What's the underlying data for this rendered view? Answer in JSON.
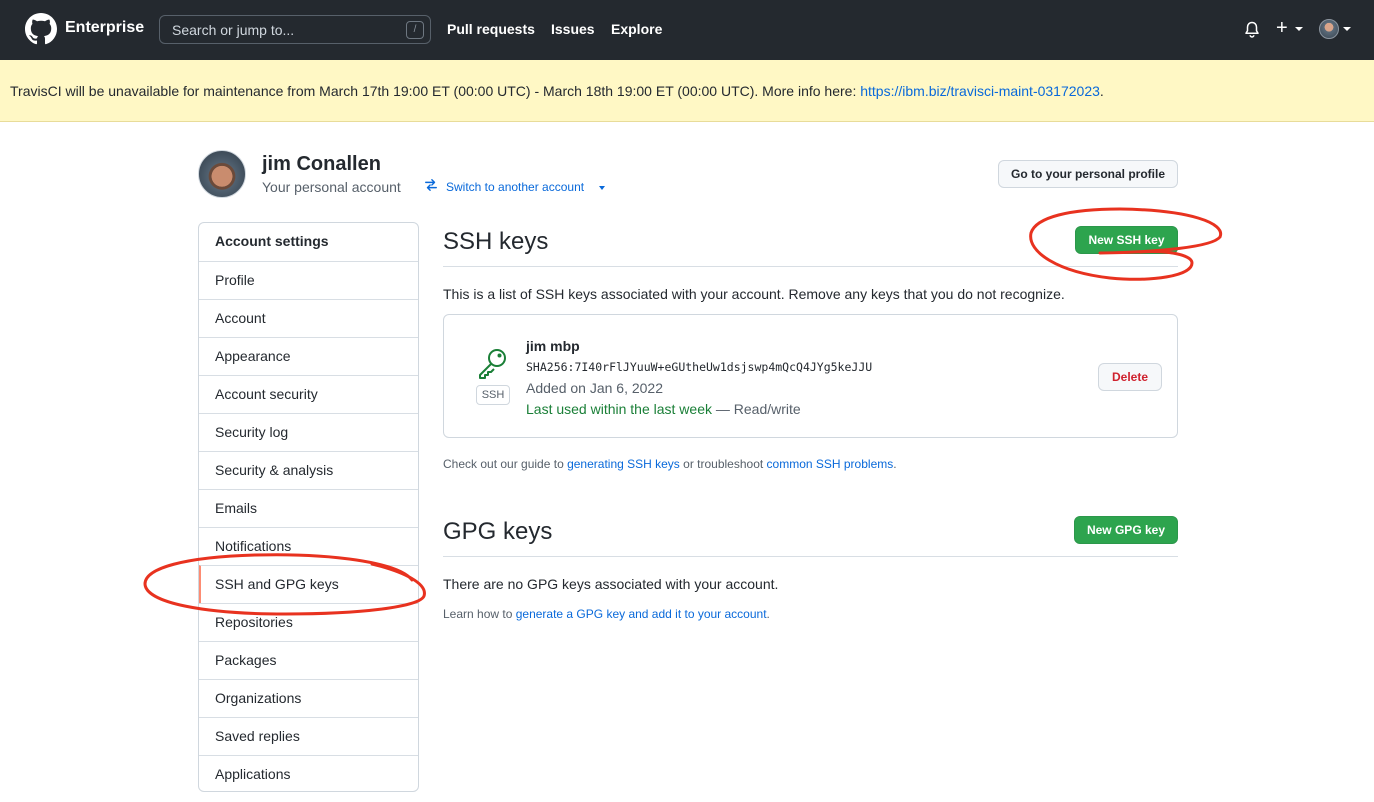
{
  "header": {
    "brand": "Enterprise",
    "search_placeholder": "Search or jump to...",
    "search_shortcut": "/",
    "nav": [
      "Pull requests",
      "Issues",
      "Explore"
    ],
    "plus_label": "+"
  },
  "banner": {
    "text": "TravisCI will be unavailable for maintenance from March 17th 19:00 ET (00:00 UTC) - March 18th 19:00 ET (00:00 UTC). More info here: ",
    "link": "https://ibm.biz/travisci-maint-03172023",
    "suffix": "."
  },
  "profile": {
    "name": "jim Conallen",
    "subtitle": "Your personal account",
    "switch_label": "Switch to another account",
    "personal_profile_button": "Go to your personal profile"
  },
  "sidebar": {
    "heading": "Account settings",
    "items": [
      {
        "label": "Profile"
      },
      {
        "label": "Account"
      },
      {
        "label": "Appearance"
      },
      {
        "label": "Account security"
      },
      {
        "label": "Security log"
      },
      {
        "label": "Security & analysis"
      },
      {
        "label": "Emails"
      },
      {
        "label": "Notifications"
      },
      {
        "label": "SSH and GPG keys",
        "selected": true
      },
      {
        "label": "Repositories"
      },
      {
        "label": "Packages"
      },
      {
        "label": "Organizations"
      },
      {
        "label": "Saved replies"
      },
      {
        "label": "Applications"
      }
    ]
  },
  "ssh": {
    "title": "SSH keys",
    "new_button": "New SSH key",
    "description": "This is a list of SSH keys associated with your account. Remove any keys that you do not recognize.",
    "keys": [
      {
        "badge": "SSH",
        "name": "jim mbp",
        "fingerprint": "SHA256:7I40rFlJYuuW+eGUtheUw1dsjswp4mQcQ4JYg5keJJU",
        "added": "Added on Jan 6, 2022",
        "last_used": "Last used within the last week",
        "access": " — Read/write",
        "delete_button": "Delete"
      }
    ],
    "guide_prefix": "Check out our guide to ",
    "guide_link1": "generating SSH keys",
    "guide_middle": " or troubleshoot ",
    "guide_link2": "common SSH problems",
    "guide_suffix": "."
  },
  "gpg": {
    "title": "GPG keys",
    "new_button": "New GPG key",
    "empty_text": "There are no GPG keys associated with your account.",
    "learn_prefix": "Learn how to ",
    "learn_link": "generate a GPG key and add it to your account",
    "learn_suffix": "."
  },
  "colors": {
    "header_bg": "#24292f",
    "banner_bg": "#fff8c5",
    "link": "#0969da",
    "primary_green": "#2da44e",
    "danger": "#cf222e",
    "annotation_red": "#e8321f"
  }
}
